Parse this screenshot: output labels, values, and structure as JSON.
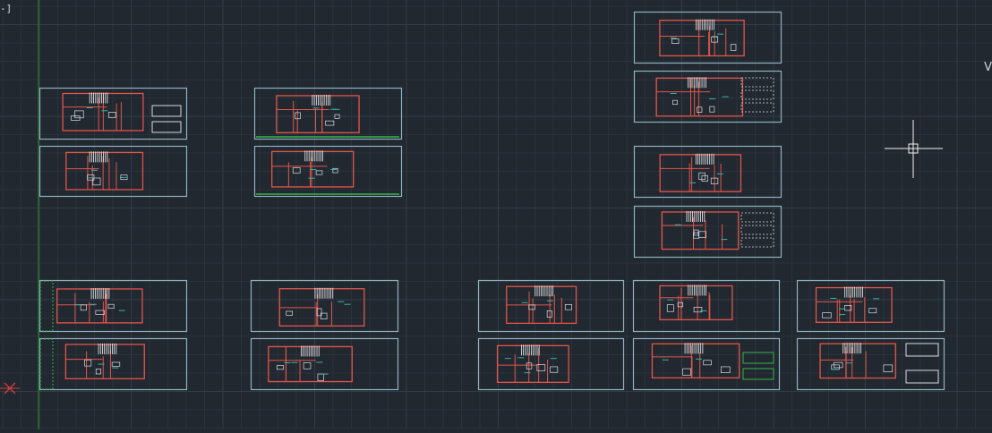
{
  "app": {
    "name": "CAD model space",
    "viewport_label": "-]",
    "edge_glyph": "V"
  },
  "colors": {
    "background": "#212830",
    "grid_minor": "#2a323b",
    "grid_major": "#333d48",
    "y_axis": "#2f8a2f",
    "sheet_frame": "#8fb0c0",
    "walls": "#e2554a",
    "stairs": "#f2f2f2",
    "furniture": "#d8dde4",
    "hatch": "#36b44a",
    "room_text": "#36b4a8",
    "crosshair": "#f2f2f2",
    "ucs_icon": "#d23b3b"
  },
  "cursor": {
    "type": "crosshair-pickbox"
  },
  "ucs_icon": {
    "type": "ucs-axis-icon"
  },
  "drawing": {
    "plan_count": 18,
    "description_type": "floor-plan-sheets"
  }
}
